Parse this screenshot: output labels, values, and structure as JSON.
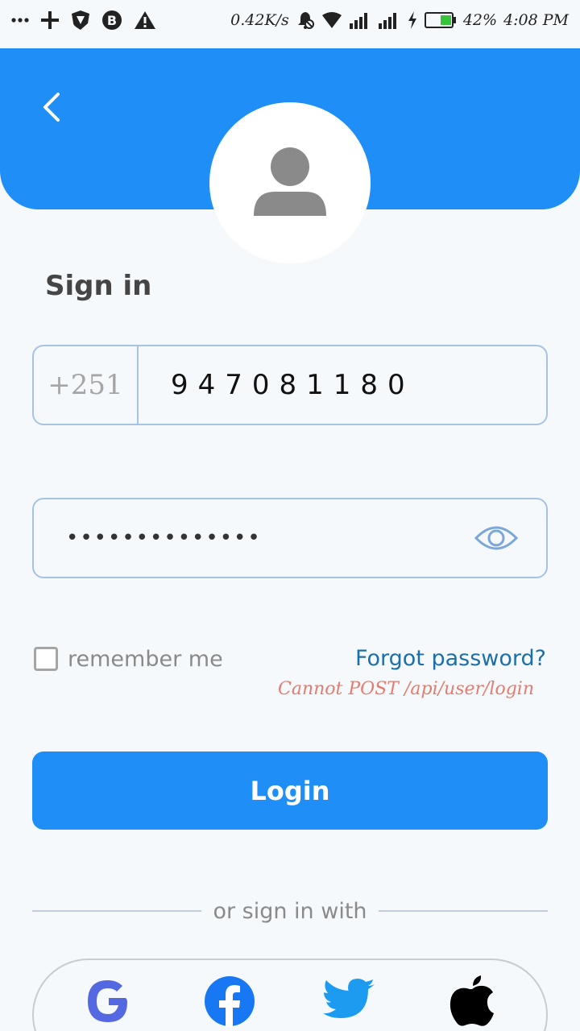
{
  "status_bar": {
    "net_speed": "0.42K/s",
    "battery": "42%",
    "time": "4:08 PM",
    "icons": [
      "more-icon",
      "plus-icon",
      "shield-icon",
      "b-badge-icon",
      "warning-icon",
      "bell-off-icon",
      "wifi-icon",
      "signal-icon",
      "signal-icon",
      "charging-icon",
      "battery-icon"
    ]
  },
  "header": {
    "back_icon": "chevron-left-icon",
    "avatar_icon": "user-icon",
    "color": "#1f8ef7"
  },
  "form": {
    "title": "Sign in",
    "country_code": "+251",
    "phone_value": "947081180",
    "password_masked": "••••••••••••••",
    "password_toggle_icon": "eye-icon",
    "remember_label": "remember me",
    "remember_checked": false,
    "forgot_label": "Forgot password?",
    "error_message": "Cannot POST /api/user/login",
    "login_label": "Login"
  },
  "social": {
    "divider_label": "or sign in with",
    "providers": [
      "google-icon",
      "facebook-icon",
      "twitter-icon",
      "apple-icon"
    ]
  },
  "colors": {
    "primary": "#1f8ef7",
    "link": "#1d6fa8",
    "error": "#e47c6e",
    "field_border": "#a7c3e3"
  }
}
